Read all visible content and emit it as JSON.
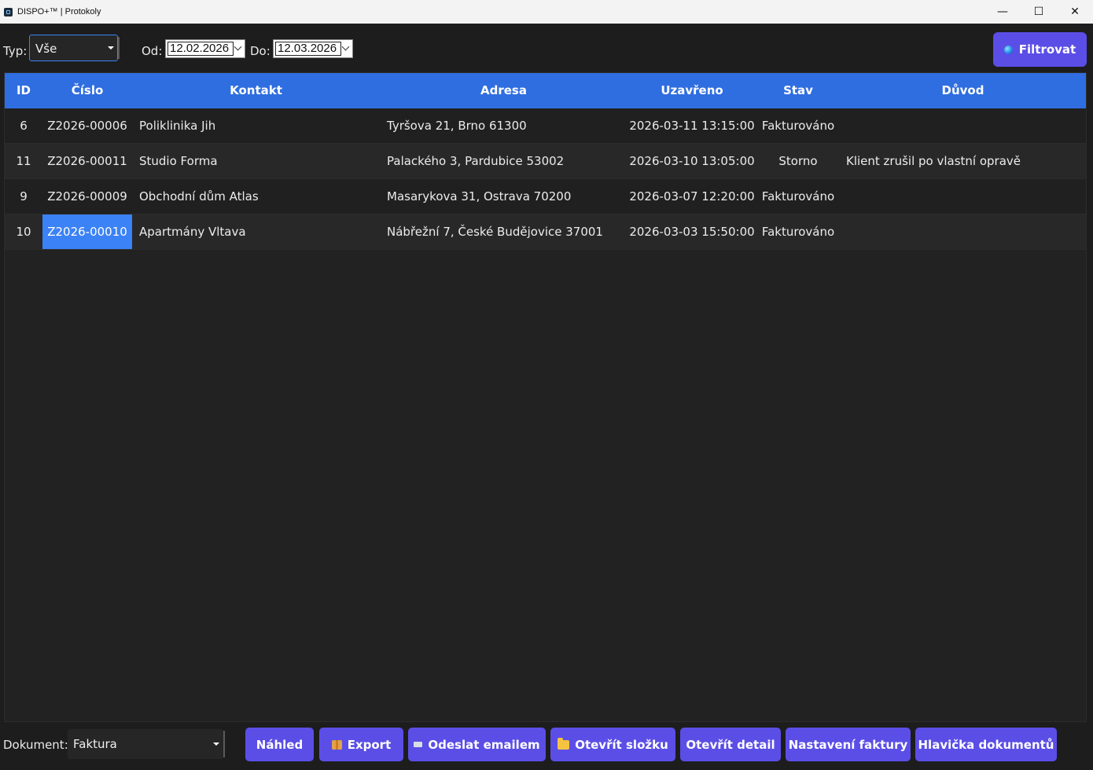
{
  "window": {
    "title": "DISPO+™ | Protokoly",
    "minimize": "—",
    "maximize": "☐",
    "close": "✕"
  },
  "filters": {
    "typ_label": "Typ:",
    "typ_value": "Vše",
    "od_label": "Od:",
    "od_value": "12.02.2026",
    "do_label": "Do:",
    "do_value": "12.03.2026",
    "filter_button": "Filtrovat"
  },
  "table": {
    "columns": [
      "ID",
      "Číslo",
      "Kontakt",
      "Adresa",
      "Uzavřeno",
      "Stav",
      "Důvod"
    ],
    "rows": [
      {
        "id": "6",
        "cislo": "Z2026-00006",
        "kontakt": "Poliklinika Jih",
        "adresa": "Tyršova 21, Brno 61300",
        "uzavreno": "2026-03-11 13:15:00",
        "stav": "Fakturováno",
        "duvod": ""
      },
      {
        "id": "11",
        "cislo": "Z2026-00011",
        "kontakt": "Studio Forma",
        "adresa": "Palackého 3, Pardubice 53002",
        "uzavreno": "2026-03-10 13:05:00",
        "stav": "Storno",
        "duvod": "Klient zrušil po vlastní opravě"
      },
      {
        "id": "9",
        "cislo": "Z2026-00009",
        "kontakt": "Obchodní dům Atlas",
        "adresa": "Masarykova 31, Ostrava 70200",
        "uzavreno": "2026-03-07 12:20:00",
        "stav": "Fakturováno",
        "duvod": ""
      },
      {
        "id": "10",
        "cislo": "Z2026-00010",
        "kontakt": "Apartmány Vltava",
        "adresa": "Nábřežní 7, České Budějovice 37001",
        "uzavreno": "2026-03-03 15:50:00",
        "stav": "Fakturováno",
        "duvod": ""
      }
    ],
    "selected_cell": {
      "row": 3,
      "column": "Číslo"
    }
  },
  "bottom": {
    "dokument_label": "Dokument:",
    "dokument_value": "Faktura",
    "buttons": {
      "nahled": "Náhled",
      "export": "Export",
      "email": "Odeslat emailem",
      "folder": "Otevřít složku",
      "detail": "Otevřít detail",
      "invoice_settings": "Nastavení faktury",
      "header": "Hlavička dokumentů"
    }
  },
  "colors": {
    "accent_button": "#5b4ee6",
    "table_header": "#2f6ee0",
    "selection": "#3b82f6",
    "background": "#1d1d1d"
  }
}
